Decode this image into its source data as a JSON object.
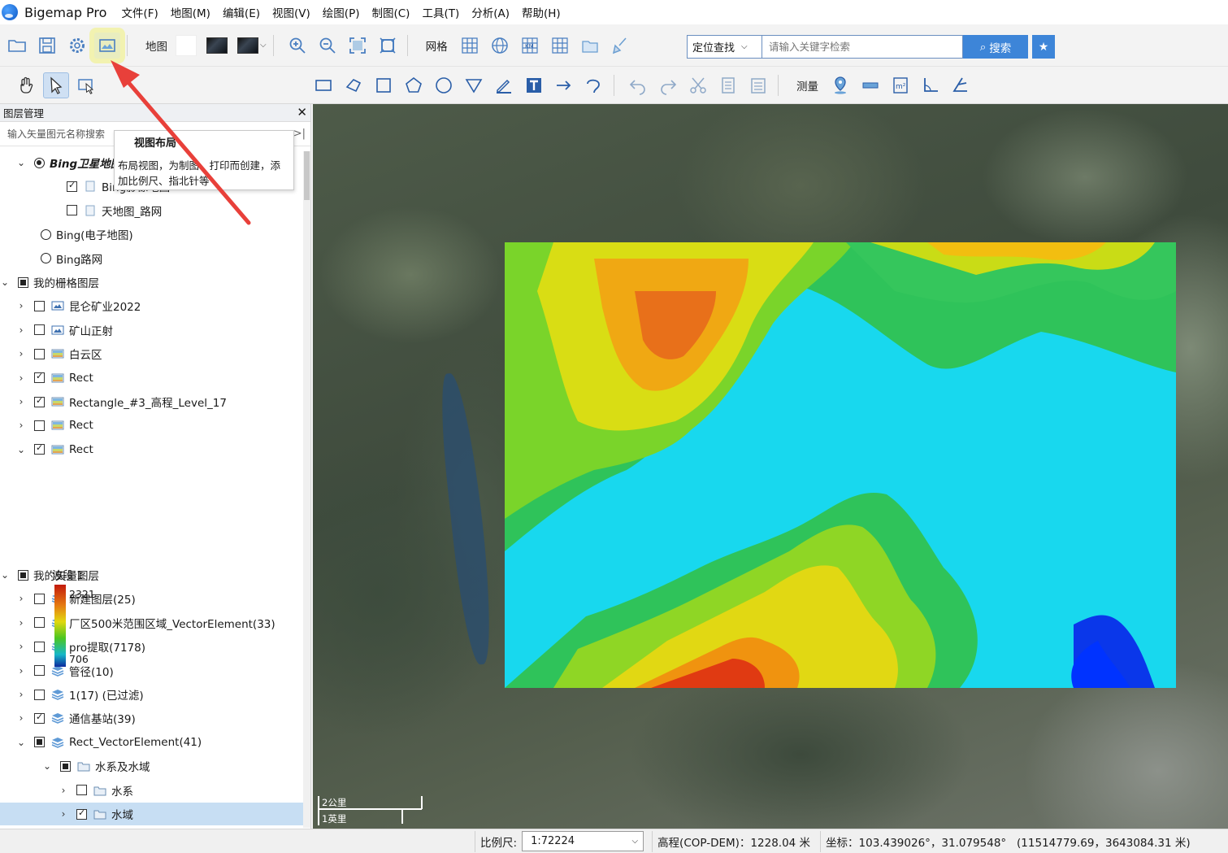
{
  "app": {
    "name": "Bigemap Pro"
  },
  "menu": [
    "文件(F)",
    "地图(M)",
    "编辑(E)",
    "视图(V)",
    "绘图(P)",
    "制图(C)",
    "工具(T)",
    "分析(A)",
    "帮助(H)"
  ],
  "toolbar": {
    "map_label": "地图",
    "grid_label": "网格",
    "measure_label": "测量",
    "search_mode": "定位查找",
    "search_placeholder": "请输入关键字检索",
    "search_button": "搜索"
  },
  "tooltip": {
    "title": "视图布局",
    "body": "布局视图，为制图、打印而创建，添加比例尺、指北针等"
  },
  "panel": {
    "title": "图层管理",
    "search_placeholder": "输入矢量图元名称搜索"
  },
  "layers": [
    {
      "label": "Bing卫星地图",
      "level": 1,
      "control": "radio-on",
      "expand": "open",
      "icon": "none",
      "style": "bi"
    },
    {
      "label": "Bing影像地图",
      "level": 2,
      "control": "checked",
      "expand": "none",
      "icon": "page"
    },
    {
      "label": "天地图_路网",
      "level": 2,
      "control": "unchecked",
      "expand": "none",
      "icon": "page"
    },
    {
      "label": "Bing(电子地图)",
      "level": 1,
      "control": "radio",
      "expand": "none",
      "icon": "none"
    },
    {
      "label": "Bing路网",
      "level": 1,
      "control": "radio",
      "expand": "none",
      "icon": "none"
    },
    {
      "label": "我的栅格图层",
      "level": 0,
      "control": "partial",
      "expand": "open",
      "icon": "none"
    },
    {
      "label": "昆仑矿业2022",
      "level": 1,
      "control": "unchecked",
      "expand": "closed",
      "icon": "image"
    },
    {
      "label": "矿山正射",
      "level": 1,
      "control": "unchecked",
      "expand": "closed",
      "icon": "image"
    },
    {
      "label": "白云区",
      "level": 1,
      "control": "unchecked",
      "expand": "closed",
      "icon": "raster"
    },
    {
      "label": "Rect",
      "level": 1,
      "control": "checked",
      "expand": "closed",
      "icon": "raster"
    },
    {
      "label": "Rectangle_#3_高程_Level_17",
      "level": 1,
      "control": "checked",
      "expand": "closed",
      "icon": "raster"
    },
    {
      "label": "Rect",
      "level": 1,
      "control": "unchecked",
      "expand": "closed",
      "icon": "raster"
    },
    {
      "label": "Rect",
      "level": 1,
      "control": "checked",
      "expand": "open",
      "icon": "raster"
    }
  ],
  "legend": {
    "band": "波段 1",
    "max": "2321",
    "min": "706"
  },
  "vector_layers": [
    {
      "label": "我的矢量图层",
      "level": 0,
      "control": "partial",
      "expand": "open",
      "icon": "none"
    },
    {
      "label": "新建图层(25)",
      "level": 1,
      "control": "unchecked",
      "expand": "closed",
      "icon": "stack"
    },
    {
      "label": "厂区500米范围区域_VectorElement(33)",
      "level": 1,
      "control": "unchecked",
      "expand": "closed",
      "icon": "stack"
    },
    {
      "label": "pro提取(7178)",
      "level": 1,
      "control": "unchecked",
      "expand": "closed",
      "icon": "stack"
    },
    {
      "label": "管径(10)",
      "level": 1,
      "control": "unchecked",
      "expand": "closed",
      "icon": "stack"
    },
    {
      "label": "1(17) (已过滤)",
      "level": 1,
      "control": "unchecked",
      "expand": "closed",
      "icon": "stack"
    },
    {
      "label": "通信基站(39)",
      "level": 1,
      "control": "checked",
      "expand": "closed",
      "icon": "stack"
    },
    {
      "label": "Rect_VectorElement(41)",
      "level": 1,
      "control": "partial",
      "expand": "open",
      "icon": "stack"
    },
    {
      "label": "水系及水域",
      "level": 2,
      "control": "partial",
      "expand": "open",
      "icon": "folder"
    },
    {
      "label": "水系",
      "level": 3,
      "control": "unchecked",
      "expand": "closed",
      "icon": "folder"
    },
    {
      "label": "水域",
      "level": 3,
      "control": "checked",
      "expand": "closed",
      "icon": "folder",
      "selected": true
    }
  ],
  "map": {
    "scale_km": "2公里",
    "scale_mi": "1英里"
  },
  "status": {
    "scale_label": "比例尺:",
    "scale_value": "1:72224",
    "elevation": "高程(COP-DEM)：1228.04 米",
    "coords": "坐标：103.439026°，31.079548°   (11514779.69，3643084.31 米)"
  },
  "colors": {
    "accent": "#3d85d8",
    "selection": "#c7def3",
    "annotation": "#e8403a"
  }
}
